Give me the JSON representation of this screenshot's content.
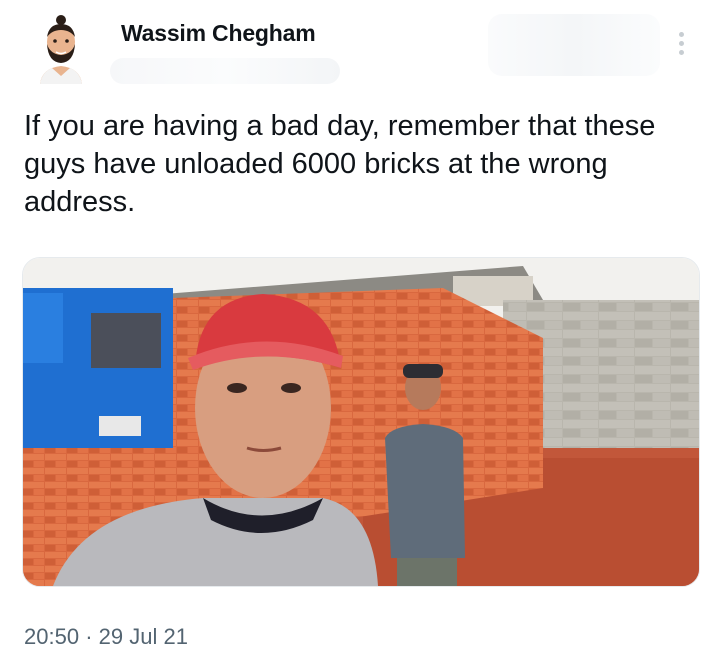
{
  "tweet": {
    "author_name": "Wassim Chegham",
    "text": "If you are having a bad day, remember that these guys have unloaded 6000 bricks at the wrong address.",
    "time": "20:50",
    "separator": "·",
    "date": "29 Jul 21"
  },
  "icons": {
    "more": "more-vertical-icon",
    "avatar": "avatar-illustration"
  },
  "colors": {
    "text": "#0f1419",
    "muted": "#536471",
    "brick": "#d9683f",
    "truck": "#1f6fd1",
    "cap": "#e0383e"
  }
}
